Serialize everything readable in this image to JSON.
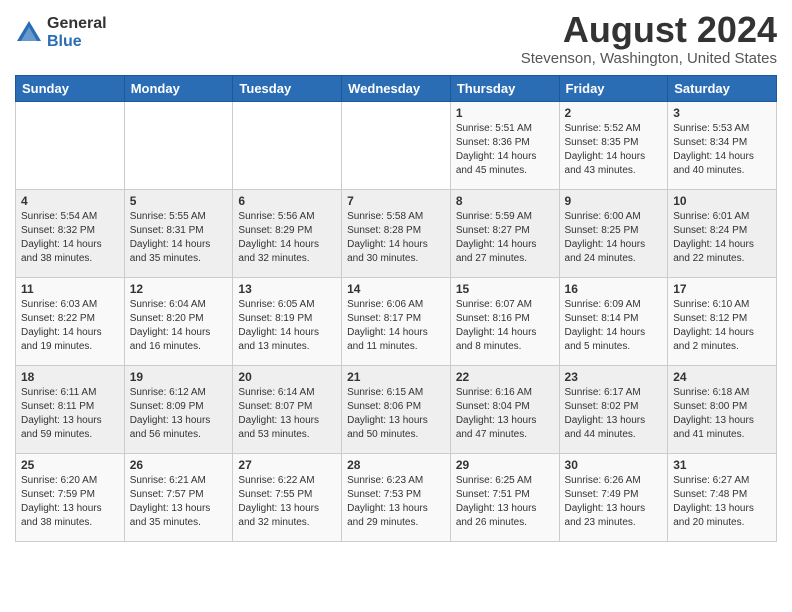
{
  "header": {
    "logo_general": "General",
    "logo_blue": "Blue",
    "month_title": "August 2024",
    "location": "Stevenson, Washington, United States"
  },
  "weekdays": [
    "Sunday",
    "Monday",
    "Tuesday",
    "Wednesday",
    "Thursday",
    "Friday",
    "Saturday"
  ],
  "weeks": [
    [
      {
        "day": "",
        "detail": ""
      },
      {
        "day": "",
        "detail": ""
      },
      {
        "day": "",
        "detail": ""
      },
      {
        "day": "",
        "detail": ""
      },
      {
        "day": "1",
        "detail": "Sunrise: 5:51 AM\nSunset: 8:36 PM\nDaylight: 14 hours\nand 45 minutes."
      },
      {
        "day": "2",
        "detail": "Sunrise: 5:52 AM\nSunset: 8:35 PM\nDaylight: 14 hours\nand 43 minutes."
      },
      {
        "day": "3",
        "detail": "Sunrise: 5:53 AM\nSunset: 8:34 PM\nDaylight: 14 hours\nand 40 minutes."
      }
    ],
    [
      {
        "day": "4",
        "detail": "Sunrise: 5:54 AM\nSunset: 8:32 PM\nDaylight: 14 hours\nand 38 minutes."
      },
      {
        "day": "5",
        "detail": "Sunrise: 5:55 AM\nSunset: 8:31 PM\nDaylight: 14 hours\nand 35 minutes."
      },
      {
        "day": "6",
        "detail": "Sunrise: 5:56 AM\nSunset: 8:29 PM\nDaylight: 14 hours\nand 32 minutes."
      },
      {
        "day": "7",
        "detail": "Sunrise: 5:58 AM\nSunset: 8:28 PM\nDaylight: 14 hours\nand 30 minutes."
      },
      {
        "day": "8",
        "detail": "Sunrise: 5:59 AM\nSunset: 8:27 PM\nDaylight: 14 hours\nand 27 minutes."
      },
      {
        "day": "9",
        "detail": "Sunrise: 6:00 AM\nSunset: 8:25 PM\nDaylight: 14 hours\nand 24 minutes."
      },
      {
        "day": "10",
        "detail": "Sunrise: 6:01 AM\nSunset: 8:24 PM\nDaylight: 14 hours\nand 22 minutes."
      }
    ],
    [
      {
        "day": "11",
        "detail": "Sunrise: 6:03 AM\nSunset: 8:22 PM\nDaylight: 14 hours\nand 19 minutes."
      },
      {
        "day": "12",
        "detail": "Sunrise: 6:04 AM\nSunset: 8:20 PM\nDaylight: 14 hours\nand 16 minutes."
      },
      {
        "day": "13",
        "detail": "Sunrise: 6:05 AM\nSunset: 8:19 PM\nDaylight: 14 hours\nand 13 minutes."
      },
      {
        "day": "14",
        "detail": "Sunrise: 6:06 AM\nSunset: 8:17 PM\nDaylight: 14 hours\nand 11 minutes."
      },
      {
        "day": "15",
        "detail": "Sunrise: 6:07 AM\nSunset: 8:16 PM\nDaylight: 14 hours\nand 8 minutes."
      },
      {
        "day": "16",
        "detail": "Sunrise: 6:09 AM\nSunset: 8:14 PM\nDaylight: 14 hours\nand 5 minutes."
      },
      {
        "day": "17",
        "detail": "Sunrise: 6:10 AM\nSunset: 8:12 PM\nDaylight: 14 hours\nand 2 minutes."
      }
    ],
    [
      {
        "day": "18",
        "detail": "Sunrise: 6:11 AM\nSunset: 8:11 PM\nDaylight: 13 hours\nand 59 minutes."
      },
      {
        "day": "19",
        "detail": "Sunrise: 6:12 AM\nSunset: 8:09 PM\nDaylight: 13 hours\nand 56 minutes."
      },
      {
        "day": "20",
        "detail": "Sunrise: 6:14 AM\nSunset: 8:07 PM\nDaylight: 13 hours\nand 53 minutes."
      },
      {
        "day": "21",
        "detail": "Sunrise: 6:15 AM\nSunset: 8:06 PM\nDaylight: 13 hours\nand 50 minutes."
      },
      {
        "day": "22",
        "detail": "Sunrise: 6:16 AM\nSunset: 8:04 PM\nDaylight: 13 hours\nand 47 minutes."
      },
      {
        "day": "23",
        "detail": "Sunrise: 6:17 AM\nSunset: 8:02 PM\nDaylight: 13 hours\nand 44 minutes."
      },
      {
        "day": "24",
        "detail": "Sunrise: 6:18 AM\nSunset: 8:00 PM\nDaylight: 13 hours\nand 41 minutes."
      }
    ],
    [
      {
        "day": "25",
        "detail": "Sunrise: 6:20 AM\nSunset: 7:59 PM\nDaylight: 13 hours\nand 38 minutes."
      },
      {
        "day": "26",
        "detail": "Sunrise: 6:21 AM\nSunset: 7:57 PM\nDaylight: 13 hours\nand 35 minutes."
      },
      {
        "day": "27",
        "detail": "Sunrise: 6:22 AM\nSunset: 7:55 PM\nDaylight: 13 hours\nand 32 minutes."
      },
      {
        "day": "28",
        "detail": "Sunrise: 6:23 AM\nSunset: 7:53 PM\nDaylight: 13 hours\nand 29 minutes."
      },
      {
        "day": "29",
        "detail": "Sunrise: 6:25 AM\nSunset: 7:51 PM\nDaylight: 13 hours\nand 26 minutes."
      },
      {
        "day": "30",
        "detail": "Sunrise: 6:26 AM\nSunset: 7:49 PM\nDaylight: 13 hours\nand 23 minutes."
      },
      {
        "day": "31",
        "detail": "Sunrise: 6:27 AM\nSunset: 7:48 PM\nDaylight: 13 hours\nand 20 minutes."
      }
    ]
  ]
}
